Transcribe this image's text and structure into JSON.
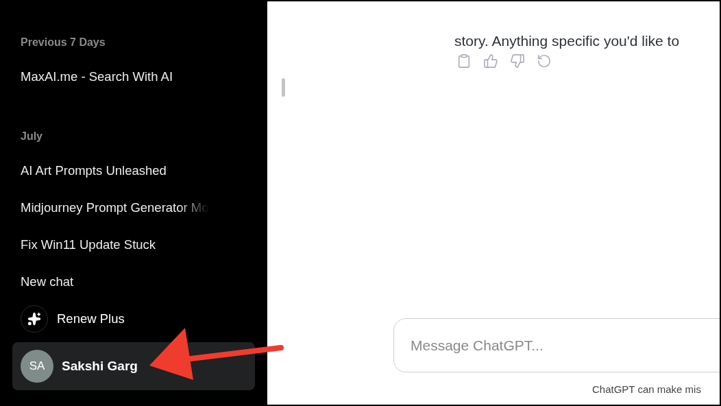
{
  "sidebar": {
    "sections": [
      {
        "heading": "Previous 7 Days",
        "items": [
          {
            "label": "MaxAI.me - Search With AI",
            "faded": false
          }
        ]
      },
      {
        "heading": "July",
        "items": [
          {
            "label": "AI Art Prompts Unleashed",
            "faded": false
          },
          {
            "label": "Midjourney Prompt Generator Mo",
            "faded": true
          },
          {
            "label": "Fix Win11 Update Stuck",
            "faded": false
          },
          {
            "label": "New chat",
            "faded": false
          }
        ]
      }
    ],
    "renew": {
      "label": "Renew Plus"
    },
    "user": {
      "initials": "SA",
      "name": "Sakshi Garg",
      "selected": true
    }
  },
  "chat": {
    "message_tail": "story. Anything specific you'd like to",
    "composer": {
      "placeholder": "Message ChatGPT..."
    },
    "footer": "ChatGPT can make mis"
  }
}
